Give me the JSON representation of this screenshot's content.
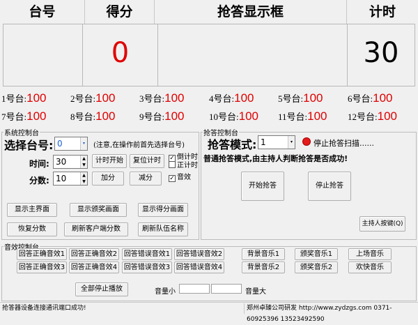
{
  "header": {
    "col_team": "台号",
    "col_score": "得分",
    "col_display": "抢答显示框",
    "col_timer": "计时"
  },
  "board": {
    "score": "0",
    "timer": "30",
    "score_color": "#e00000"
  },
  "teams": [
    {
      "label": "1号台:",
      "score": "100"
    },
    {
      "label": "2号台:",
      "score": "100"
    },
    {
      "label": "3号台:",
      "score": "100"
    },
    {
      "label": "4号台:",
      "score": "100"
    },
    {
      "label": "5号台:",
      "score": "100"
    },
    {
      "label": "6号台:",
      "score": "100"
    },
    {
      "label": "7号台:",
      "score": "100"
    },
    {
      "label": "8号台:",
      "score": "100"
    },
    {
      "label": "9号台:",
      "score": "100"
    },
    {
      "label": "10号台:",
      "score": "100"
    },
    {
      "label": "11号台:",
      "score": "100"
    },
    {
      "label": "12号台:",
      "score": "100"
    }
  ],
  "system": {
    "legend": "系统控制台",
    "select_label": "选择台号:",
    "select_value": "0",
    "select_note": "(注意,在操作前首先选择台号)",
    "time_label": "时间:",
    "time_value": "30",
    "score_label": "分数:",
    "score_value": "10",
    "btn_start_timer": "计时开始",
    "btn_reset_timer": "复位计时",
    "btn_add": "加分",
    "btn_sub": "减分",
    "chk_countdown": "倒计时",
    "chk_countup": "正计时",
    "chk_sound": "音效",
    "btn_show_main": "显示主界面",
    "btn_show_award": "显示颁奖画面",
    "btn_show_score": "显示得分画面",
    "btn_restore_score": "恢复分数",
    "btn_refresh_client": "刷新客户端分数",
    "btn_refresh_names": "刷新队伍名称"
  },
  "buzzer": {
    "legend": "抢答控制台",
    "mode_label": "抢答模式:",
    "mode_value": "1",
    "scan_status": "停止抢答扫描......",
    "indicator_color": "#e41b1b",
    "mode_desc": "普通抢答模式,由主持人判断抢答是否成功!",
    "btn_start": "开始抢答",
    "btn_stop": "停止抢答",
    "btn_host": "主持人按键(Q)"
  },
  "sound": {
    "legend": "音效控制台",
    "row1": [
      "回答正确音效1",
      "回答正确音效2",
      "回答错误音效1",
      "回答错误音效2",
      "背景音乐1",
      "颁奖音乐1",
      "上场音乐"
    ],
    "row2": [
      "回答正确音效3",
      "回答正确音效4",
      "回答错误音效3",
      "回答错误音效4",
      "背景音乐2",
      "颁奖音乐2",
      "欢快音乐"
    ],
    "btn_stop_all": "全部停止播放",
    "vol_low": "音量小",
    "vol_high": "音量大"
  },
  "statusbar": {
    "left": "抢答器设备连接通讯端口成功!",
    "right": "郑州卓臻公司研发 http://www.zydzgs.com 0371-60925396 13523492590"
  }
}
